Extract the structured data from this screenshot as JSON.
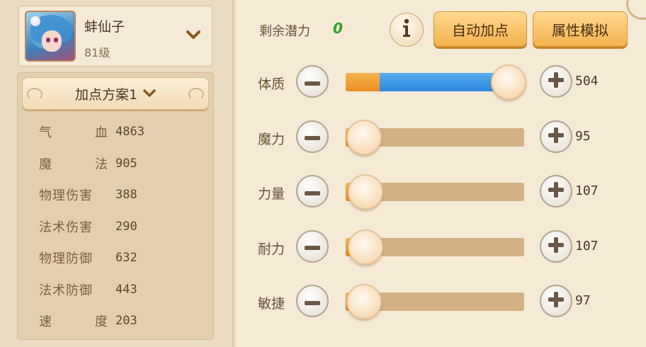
{
  "character": {
    "name": "蚌仙子",
    "level": "81级"
  },
  "plan": {
    "label": "加点方案1"
  },
  "stats": [
    {
      "label": "气血",
      "value": "4863",
      "spread": true
    },
    {
      "label": "魔法",
      "value": "905",
      "spread": true
    },
    {
      "label": "物理伤害",
      "value": "388",
      "spread": false
    },
    {
      "label": "法术伤害",
      "value": "290",
      "spread": false
    },
    {
      "label": "物理防御",
      "value": "632",
      "spread": false
    },
    {
      "label": "法术防御",
      "value": "443",
      "spread": false
    },
    {
      "label": "速度",
      "value": "203",
      "spread": true
    }
  ],
  "potential": {
    "label": "剩余潜力",
    "value": "0"
  },
  "buttons": {
    "auto_allocate": "自动加点",
    "simulate": "属性模拟"
  },
  "attributes": [
    {
      "label": "体质",
      "value": "504",
      "slider_fraction": 0.98,
      "has_pending": true
    },
    {
      "label": "魔力",
      "value": "95",
      "slider_fraction": 0.08,
      "has_pending": false
    },
    {
      "label": "力量",
      "value": "107",
      "slider_fraction": 0.09,
      "has_pending": false
    },
    {
      "label": "耐力",
      "value": "107",
      "slider_fraction": 0.09,
      "has_pending": false
    },
    {
      "label": "敏捷",
      "value": "97",
      "slider_fraction": 0.08,
      "has_pending": false
    }
  ],
  "colors": {
    "orange_fill": "#e98e21",
    "blue_fill": "#2f86dd",
    "potential_green": "#2fa22a"
  },
  "icons": {
    "info": "info-icon",
    "plus": "plus-icon",
    "minus": "minus-icon",
    "chevron": "chevron-down-icon"
  }
}
